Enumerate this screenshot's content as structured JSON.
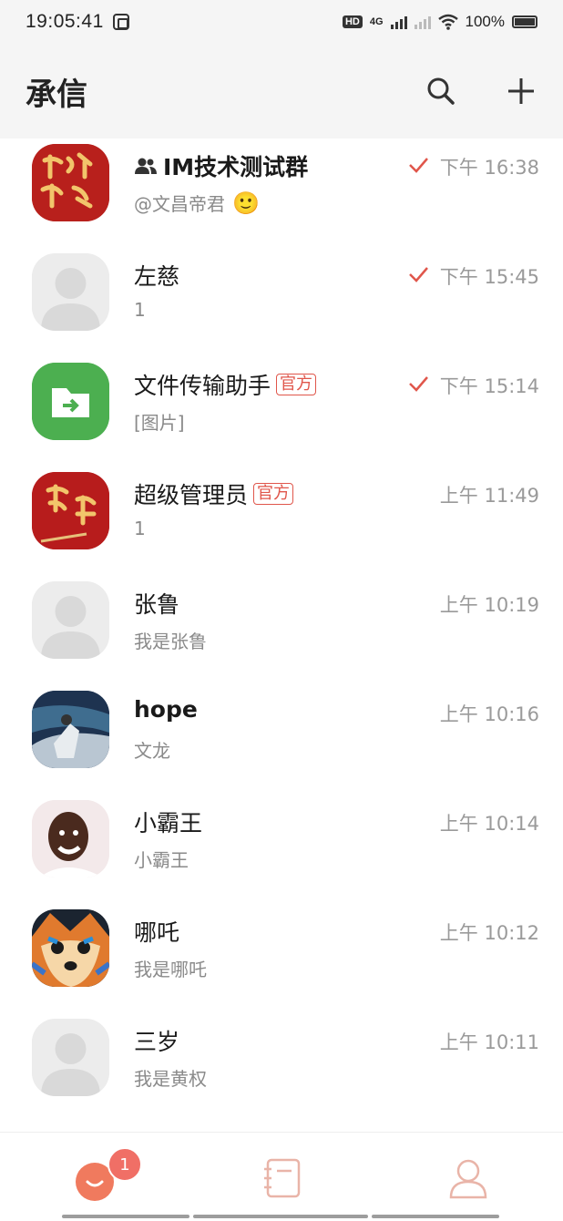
{
  "status_bar": {
    "time": "19:05:41",
    "hd": "HD",
    "network": "4G",
    "battery": "100%"
  },
  "header": {
    "title": "承信",
    "search_icon": "search-icon",
    "add_icon": "plus-icon"
  },
  "colors": {
    "accent": "#e0564b",
    "tab_active": "#f07a5e",
    "tab_inactive": "#e9b4a8"
  },
  "conversations": [
    {
      "name": "IM技术测试群",
      "preview": "@文昌帝君",
      "time": "下午 16:38",
      "group": true,
      "sent": true,
      "emoji": "🙂"
    },
    {
      "name": "左慈",
      "preview": "1",
      "time": "下午 15:45",
      "sent": true
    },
    {
      "name": "文件传输助手",
      "tag": "官方",
      "preview": "[图片]",
      "time": "下午 15:14",
      "sent": true
    },
    {
      "name": "超级管理员",
      "tag": "官方",
      "preview": "1",
      "time": "上午 11:49"
    },
    {
      "name": "张鲁",
      "preview": "我是张鲁",
      "time": "上午 10:19"
    },
    {
      "name": "hope",
      "preview": "文龙",
      "time": "上午 10:16"
    },
    {
      "name": "小霸王",
      "preview": "小霸王",
      "time": "上午 10:14"
    },
    {
      "name": "哪吒",
      "preview": "我是哪吒",
      "time": "上午 10:12"
    },
    {
      "name": "三岁",
      "preview": "我是黄权",
      "time": "上午 10:11"
    }
  ],
  "tabbar": {
    "messages_badge": "1",
    "tabs": [
      "messages-tab",
      "contacts-tab",
      "profile-tab"
    ]
  }
}
